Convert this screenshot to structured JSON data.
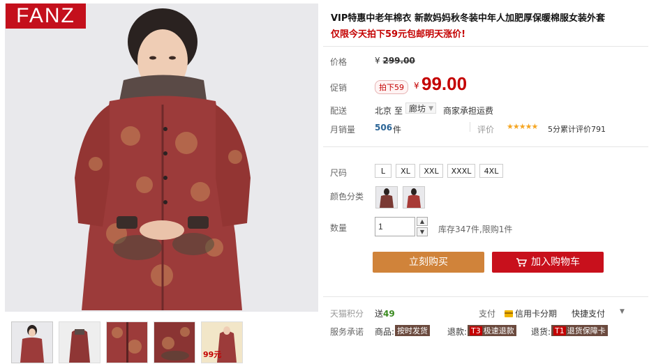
{
  "brand": {
    "logo_text": "FANZ",
    "logo_color": "#c4101c"
  },
  "product": {
    "title": "VIP特惠中老年棉衣 新款妈妈秋冬装中年人加肥厚保暖棉服女装外套",
    "promo_line": "仅限今天拍下59元包邮明天涨价!"
  },
  "price": {
    "label": "价格",
    "original_currency": "¥",
    "original": "299.00"
  },
  "promotion": {
    "label": "促销",
    "badge": "拍下59",
    "currency": "¥",
    "price": "99.00"
  },
  "shipping": {
    "label": "配送",
    "from": "北京",
    "to_word": "至",
    "city": "廊坊",
    "note": "商家承担运费"
  },
  "sales": {
    "label": "月销量",
    "count": "506",
    "unit": "件"
  },
  "review": {
    "label": "评价",
    "stars": "★★★★★",
    "rating": 5,
    "text": "5分累计评价791"
  },
  "sizes": {
    "label": "尺码",
    "options": [
      "L",
      "XL",
      "XXL",
      "XXXL",
      "4XL"
    ]
  },
  "colors": {
    "label": "颜色分类",
    "count": 2
  },
  "quantity": {
    "label": "数量",
    "value": "1",
    "up_icon": "chevron-up-icon",
    "down_icon": "chevron-down-icon",
    "stock": "库存347件,限购1件"
  },
  "actions": {
    "buy_now": "立刻购买",
    "add_cart": "加入购物车",
    "buy_color": "#d0833a",
    "cart_color": "#c8101c"
  },
  "tmall": {
    "label": "天猫积分",
    "points_prefix": "送",
    "points": "49"
  },
  "payment": {
    "label": "支付",
    "credit": "信用卡分期",
    "quick": "快捷支付"
  },
  "services": {
    "label": "服务承诺",
    "goods_label": "商品:",
    "goods_tag": "按时发货",
    "refund_label": "退款:",
    "refund_code": "T3",
    "refund_tag": "极速退款",
    "return_label": "退货:",
    "return_code": "T1",
    "return_tag": "退货保障卡"
  },
  "thumbnails": {
    "count": 5,
    "last_badge": "99元"
  }
}
